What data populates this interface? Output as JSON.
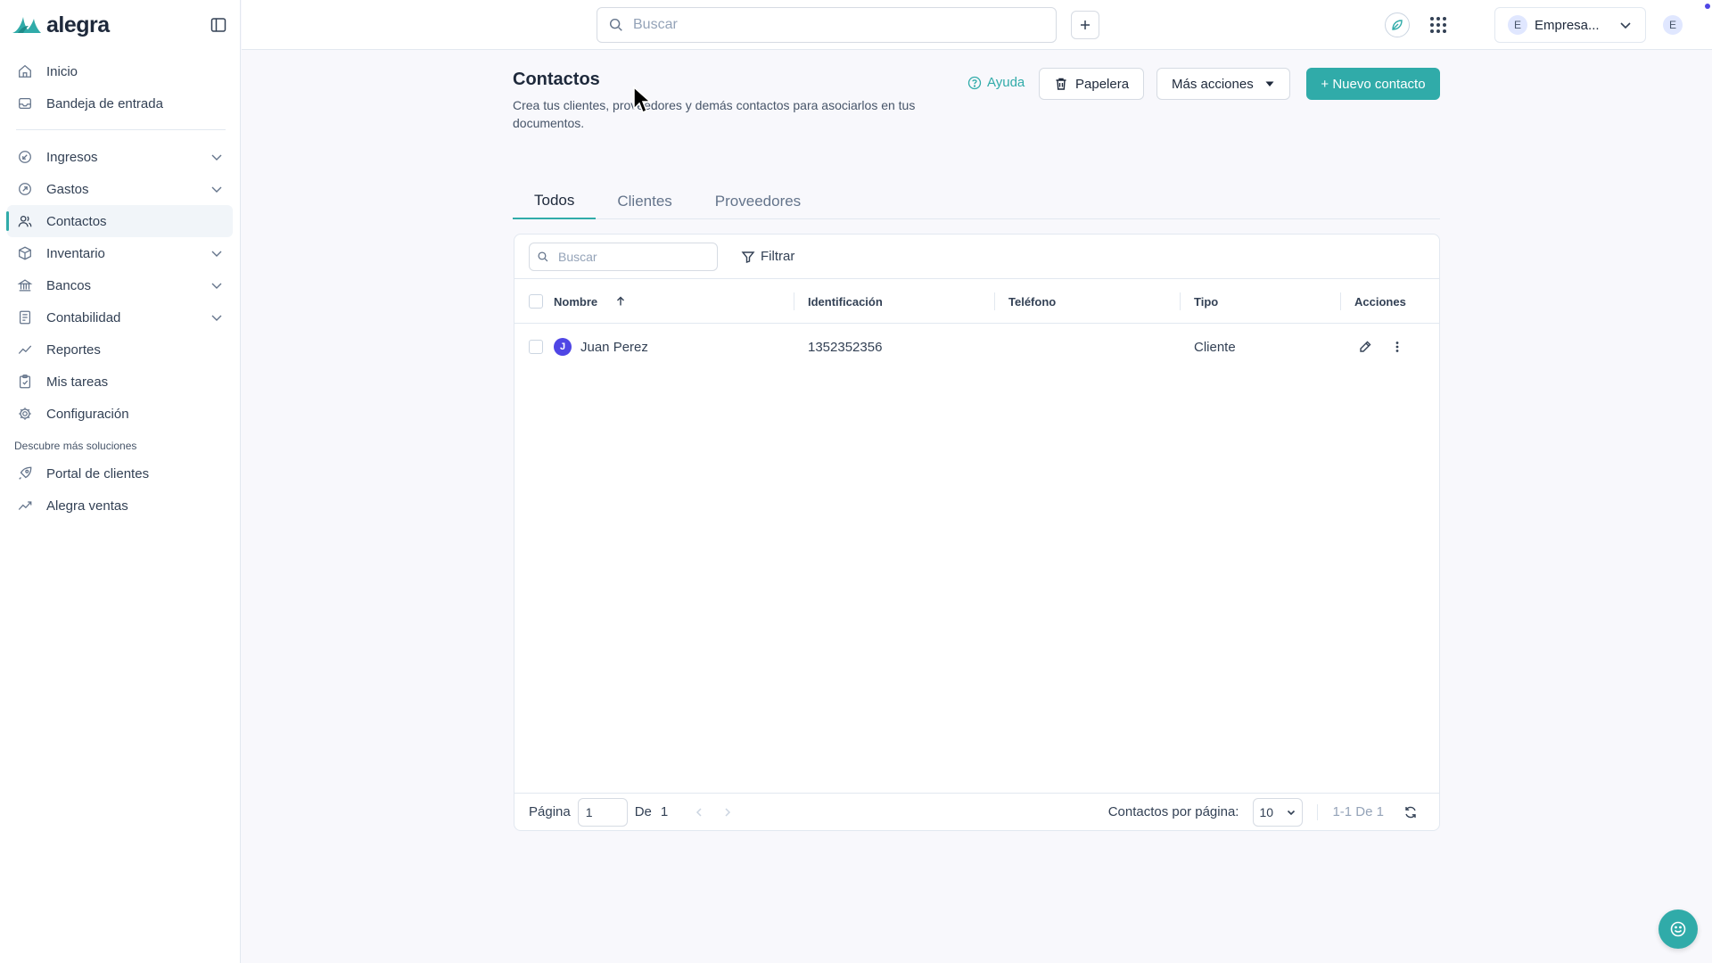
{
  "brand": {
    "name": "alegra",
    "accent": "#30aba9"
  },
  "sidebar": {
    "items_top": [
      {
        "label": "Inicio",
        "icon": "home-icon"
      },
      {
        "label": "Bandeja de entrada",
        "icon": "inbox-icon"
      }
    ],
    "items_main": [
      {
        "label": "Ingresos",
        "icon": "income-icon",
        "expandable": true
      },
      {
        "label": "Gastos",
        "icon": "expenses-icon",
        "expandable": true
      },
      {
        "label": "Contactos",
        "icon": "contacts-icon",
        "active": true
      },
      {
        "label": "Inventario",
        "icon": "box-icon",
        "expandable": true
      },
      {
        "label": "Bancos",
        "icon": "bank-icon",
        "expandable": true
      },
      {
        "label": "Contabilidad",
        "icon": "ledger-icon",
        "expandable": true
      },
      {
        "label": "Reportes",
        "icon": "trend-icon"
      },
      {
        "label": "Mis tareas",
        "icon": "clipboard-icon"
      },
      {
        "label": "Configuración",
        "icon": "gear-icon"
      }
    ],
    "section_title": "Descubre más soluciones",
    "items_extra": [
      {
        "label": "Portal de clientes",
        "icon": "rocket-icon"
      },
      {
        "label": "Alegra ventas",
        "icon": "trend-icon"
      }
    ]
  },
  "topbar": {
    "search_placeholder": "Buscar",
    "company": {
      "initial": "E",
      "name": "Empresa..."
    },
    "user_initial": "E"
  },
  "page": {
    "title": "Contactos",
    "description": "Crea tus clientes, proveedores y demás contactos para asociarlos en tus documentos.",
    "help_label": "Ayuda",
    "trash_label": "Papelera",
    "more_actions_label": "Más acciones",
    "new_contact_label": "+ Nuevo contacto"
  },
  "tabs": [
    {
      "label": "Todos",
      "active": true
    },
    {
      "label": "Clientes",
      "active": false
    },
    {
      "label": "Proveedores",
      "active": false
    }
  ],
  "table": {
    "search_placeholder": "Buscar",
    "filter_label": "Filtrar",
    "columns": [
      "Nombre",
      "Identificación",
      "Teléfono",
      "Tipo",
      "Acciones"
    ],
    "rows": [
      {
        "initial": "J",
        "name": "Juan Perez",
        "id": "1352352356",
        "phone": "",
        "type": "Cliente"
      }
    ],
    "footer": {
      "page_label": "Página",
      "page_value": "1",
      "of_label": "De",
      "total_pages": "1",
      "per_page_label": "Contactos por página:",
      "per_page_value": "10",
      "range_label": "1-1 De 1"
    }
  }
}
